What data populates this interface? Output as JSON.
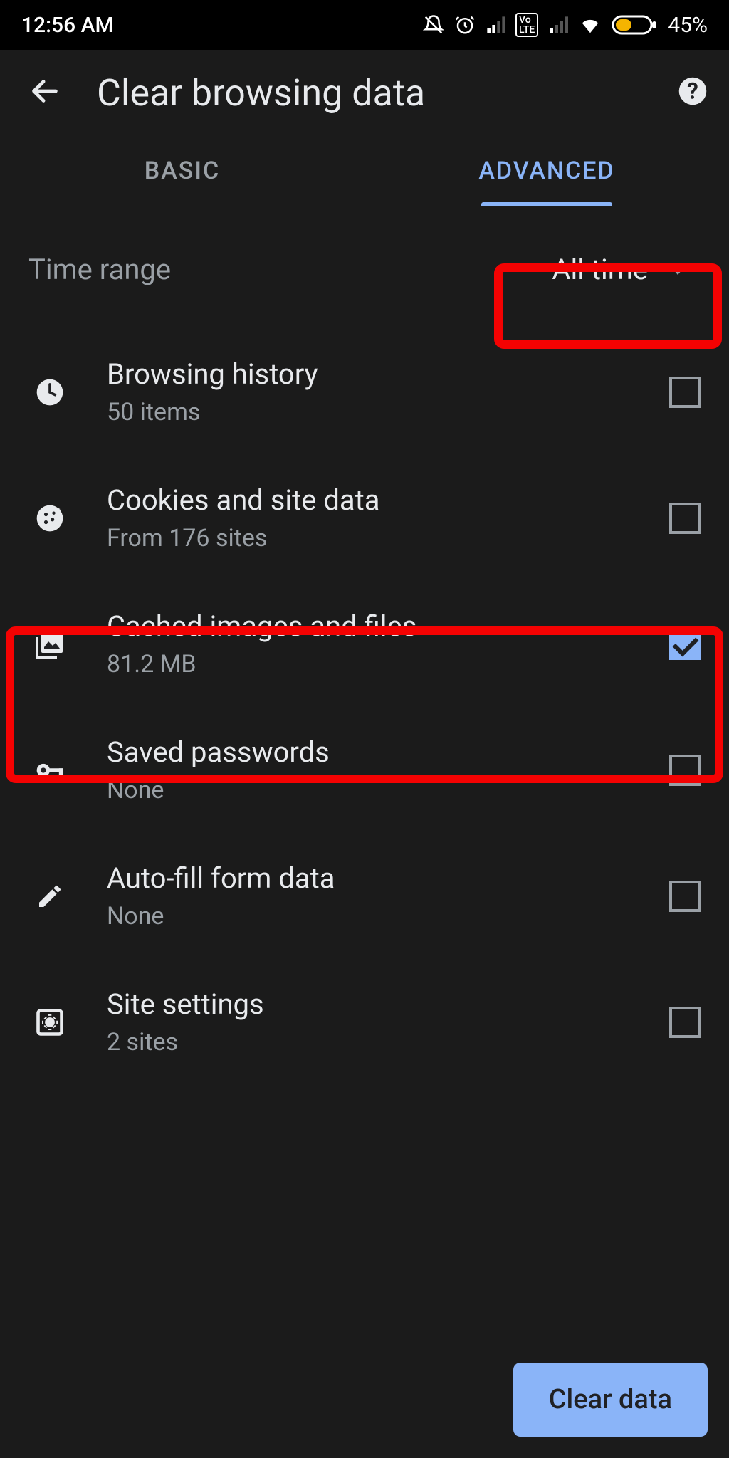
{
  "status": {
    "time": "12:56 AM",
    "battery_pct": "45%"
  },
  "header": {
    "title": "Clear browsing data"
  },
  "tabs": {
    "basic": "BASIC",
    "advanced": "ADVANCED",
    "active": "advanced"
  },
  "time_range": {
    "label": "Time range",
    "value": "All time"
  },
  "items": [
    {
      "icon": "clock",
      "name": "Browsing history",
      "sub": "50 items",
      "checked": false
    },
    {
      "icon": "cookie",
      "name": "Cookies and site data",
      "sub": "From 176 sites",
      "checked": false
    },
    {
      "icon": "image",
      "name": "Cached images and files",
      "sub": "81.2 MB",
      "checked": true
    },
    {
      "icon": "key",
      "name": "Saved passwords",
      "sub": "None",
      "checked": false
    },
    {
      "icon": "pencil",
      "name": "Auto-fill form data",
      "sub": "None",
      "checked": false
    },
    {
      "icon": "gearbox",
      "name": "Site settings",
      "sub": "2 sites",
      "checked": false
    }
  ],
  "action": {
    "clear_label": "Clear data"
  },
  "colors": {
    "accent": "#8ab4f8",
    "bg": "#1b1b1b",
    "highlight": "#f40202"
  }
}
